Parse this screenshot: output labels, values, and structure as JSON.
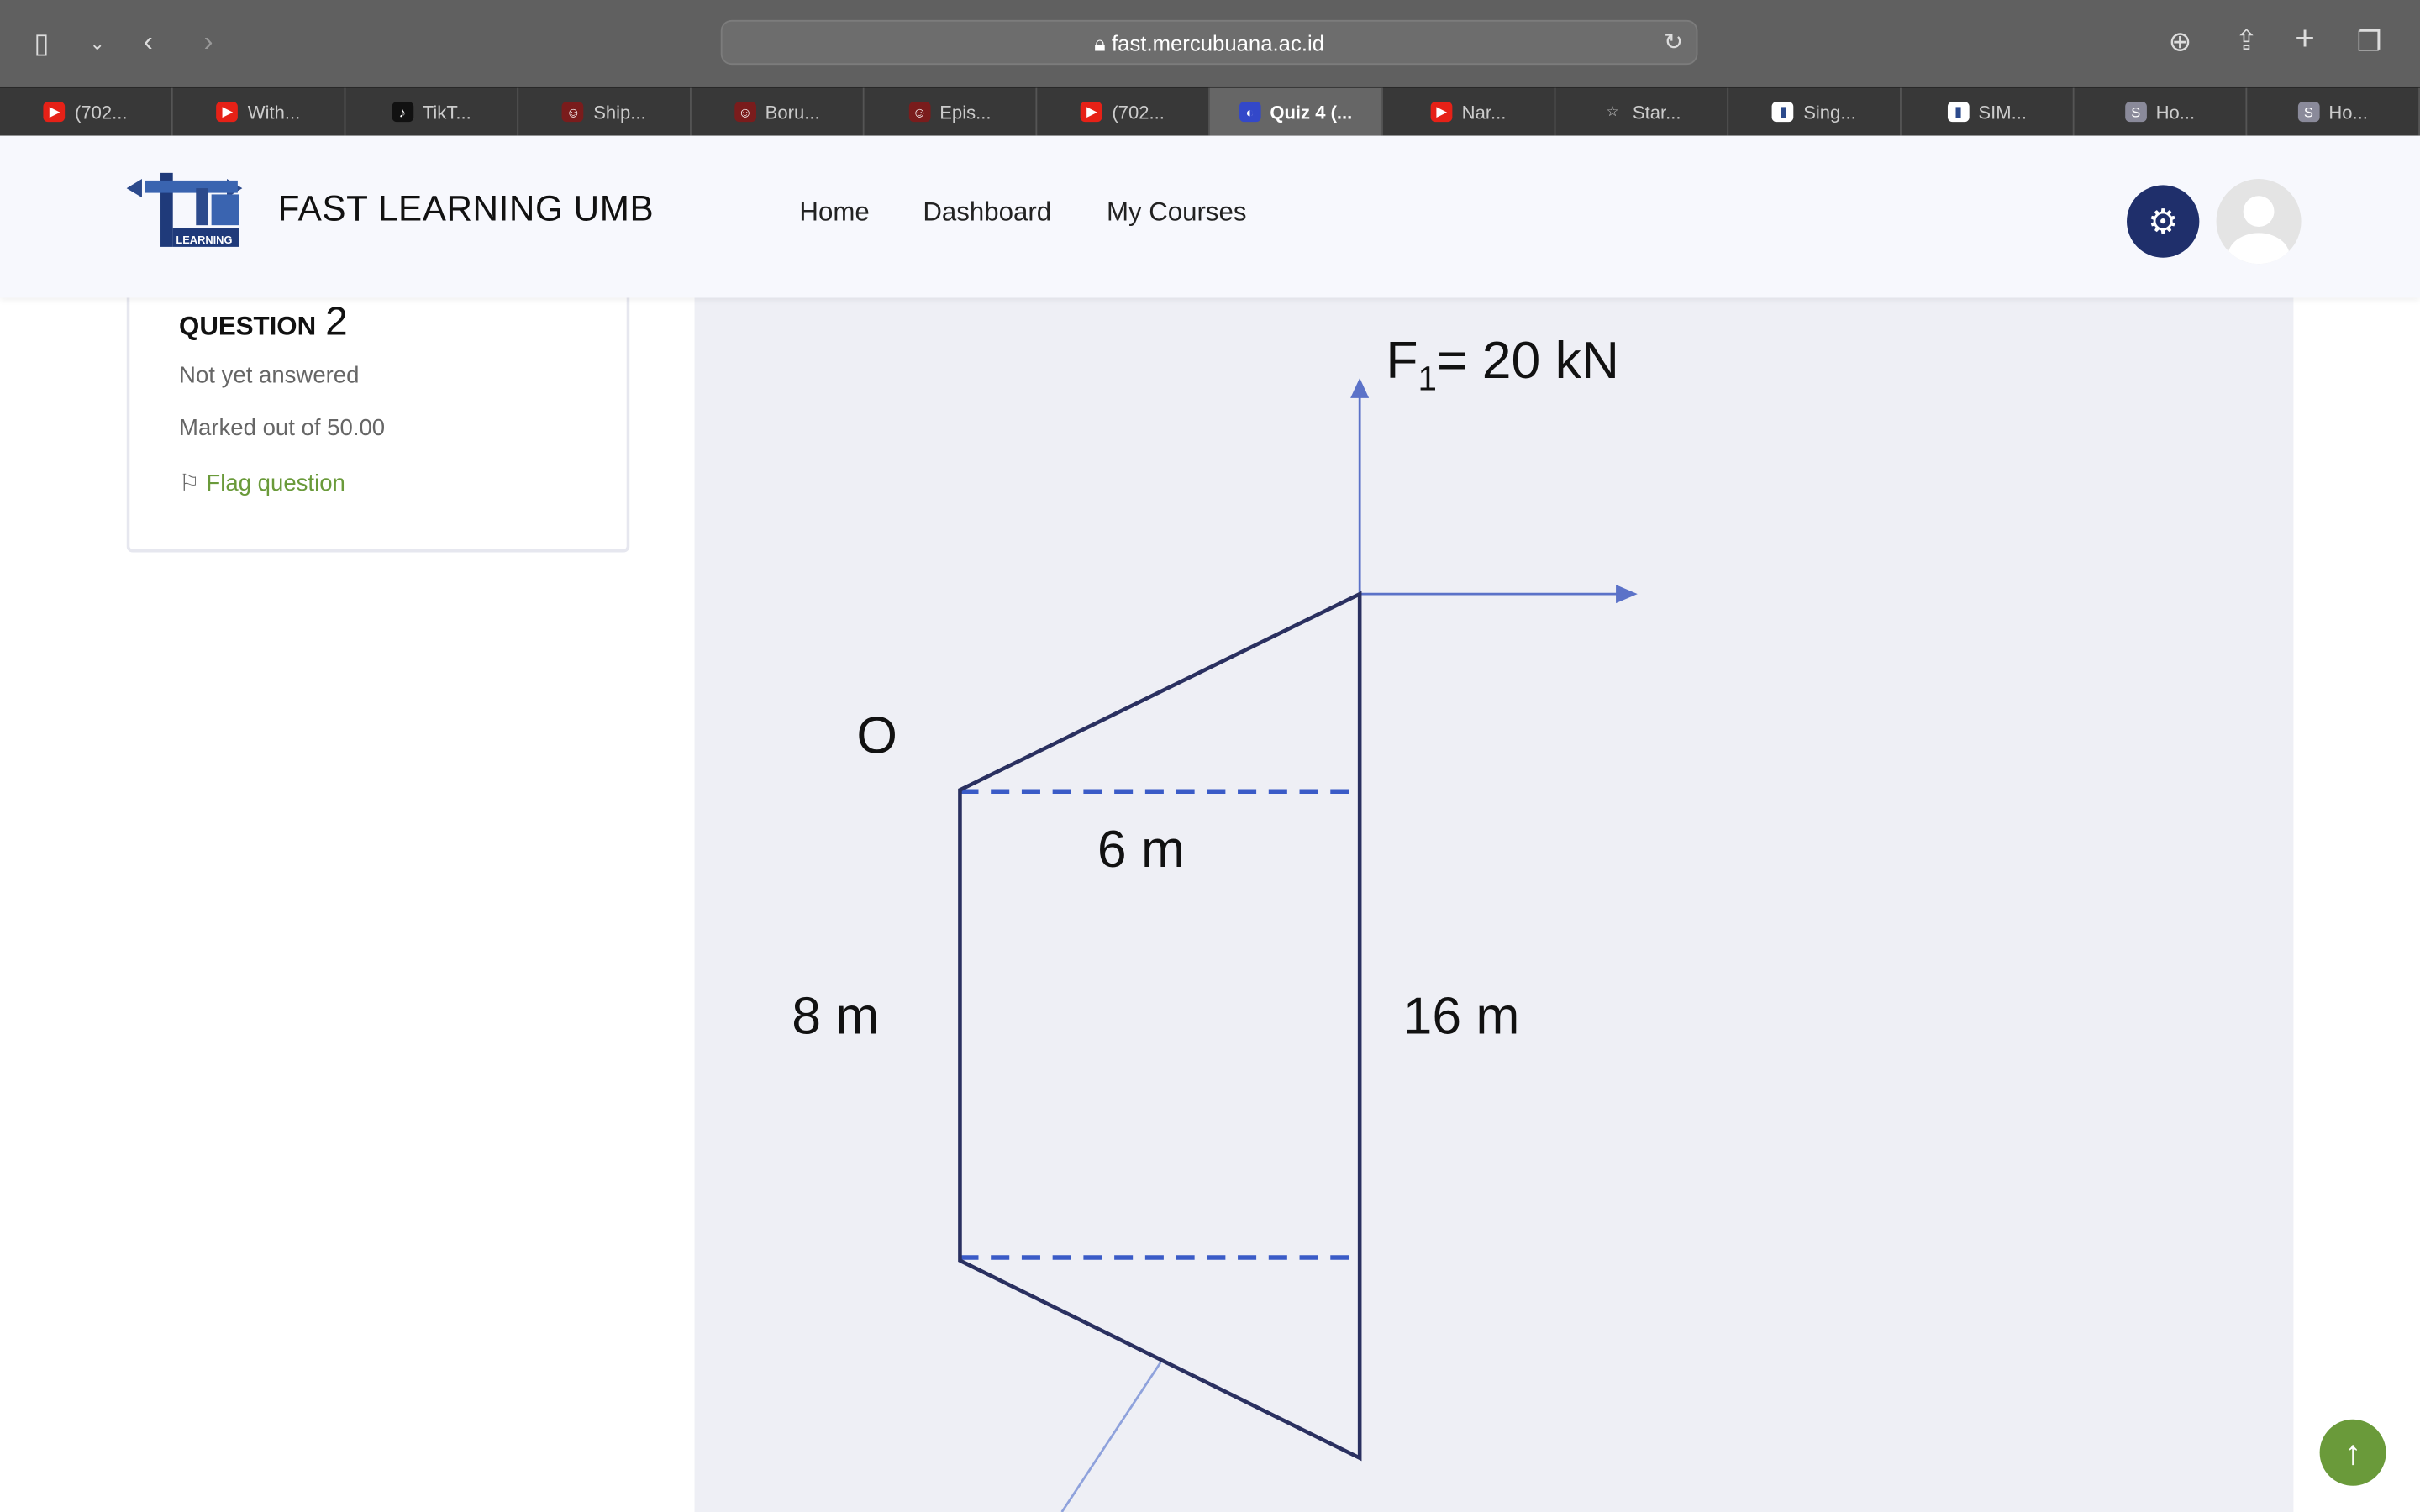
{
  "browser": {
    "url": "fast.mercubuana.ac.id",
    "tabs": [
      {
        "label": "(702...",
        "icon": "youtube"
      },
      {
        "label": "With...",
        "icon": "youtube"
      },
      {
        "label": "TikT...",
        "icon": "tiktok"
      },
      {
        "label": "Ship...",
        "icon": "anime"
      },
      {
        "label": "Boru...",
        "icon": "anime"
      },
      {
        "label": "Epis...",
        "icon": "anime"
      },
      {
        "label": "(702...",
        "icon": "youtube"
      },
      {
        "label": "Quiz 4 (...",
        "icon": "umb",
        "active": true
      },
      {
        "label": "Nar...",
        "icon": "youtube"
      },
      {
        "label": "Star...",
        "icon": "star"
      },
      {
        "label": "Sing...",
        "icon": "flame"
      },
      {
        "label": "SIM...",
        "icon": "flame"
      },
      {
        "label": "Ho...",
        "icon": "s-badge"
      },
      {
        "label": "Ho...",
        "icon": "s-badge"
      }
    ]
  },
  "site": {
    "brand": "FAST LEARNING UMB",
    "logo_text": "LEARNING",
    "nav": [
      "Home",
      "Dashboard",
      "My Courses"
    ]
  },
  "question": {
    "label": "QUESTION",
    "number": "2",
    "status": "Not yet answered",
    "marks": "Marked out of 50.00",
    "flag": "Flag question"
  },
  "diagram": {
    "force_label": "F",
    "force_sub": "1",
    "force_value": "= 20 kN",
    "point": "O",
    "width_label": "6 m",
    "left_label": "8 m",
    "right_label": "16 m"
  },
  "colors": {
    "accent": "#1f2f6b",
    "flag": "#6a9a3a",
    "arrow": "#5b72c8"
  }
}
